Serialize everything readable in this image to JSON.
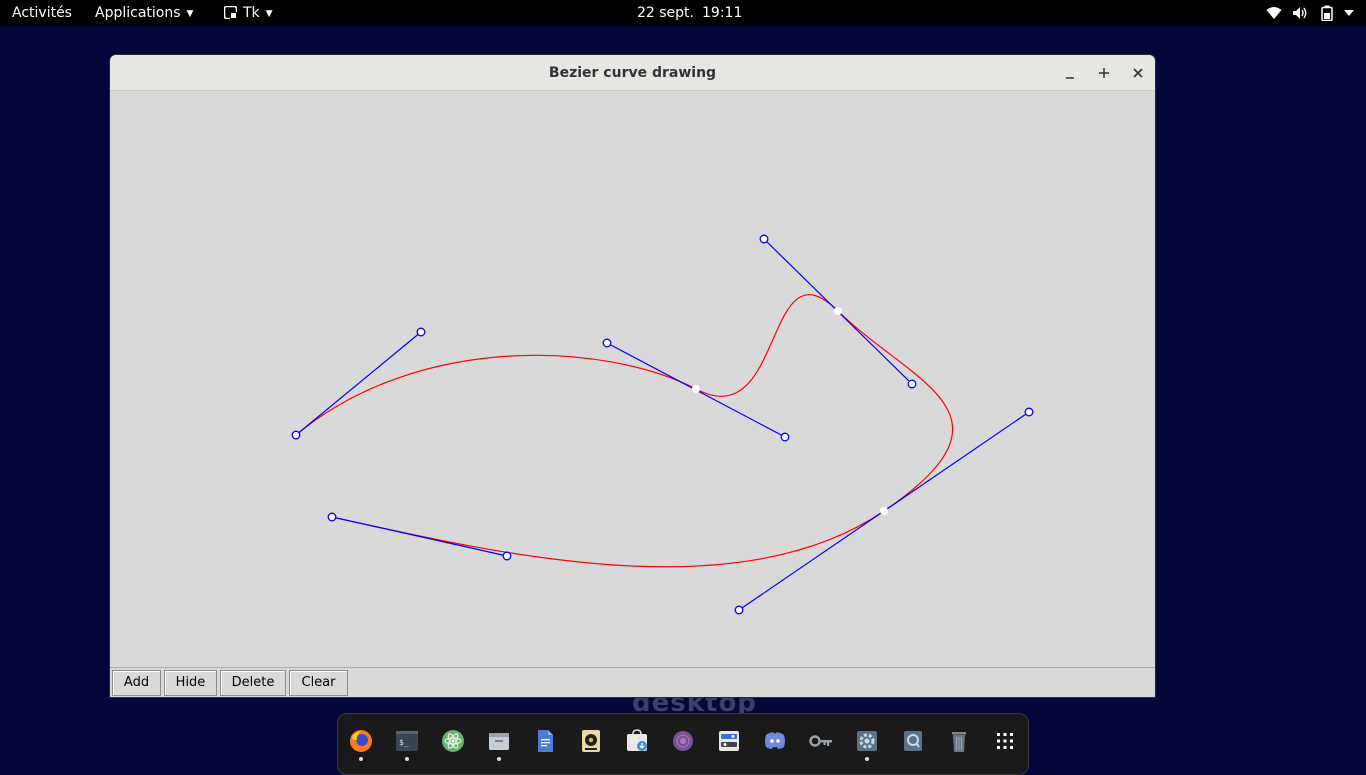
{
  "topbar": {
    "activities": "Activités",
    "applications": "Applications",
    "app_name": "Tk",
    "date": "22 sept.",
    "time": "19:11",
    "tray_icons": [
      "wifi-icon",
      "volume-icon",
      "battery-icon",
      "power-menu-arrow-icon"
    ]
  },
  "window": {
    "title": "Bezier curve drawing",
    "controls": [
      "minimize-icon",
      "maximize-icon",
      "close-icon"
    ]
  },
  "buttons": {
    "add": "Add",
    "hide": "Hide",
    "delete": "Delete",
    "clear": "Clear"
  },
  "background_text": "desktop",
  "drawing": {
    "curve_color": "#ff0000",
    "handle_color": "#0000ff",
    "anchor_color": "#ffffff"
  },
  "dock": {
    "items": [
      {
        "icon": "firefox-icon",
        "running": true
      },
      {
        "icon": "terminal-icon",
        "running": true
      },
      {
        "icon": "atom-icon",
        "running": false
      },
      {
        "icon": "files-icon",
        "running": true
      },
      {
        "icon": "text-editor-icon",
        "running": false
      },
      {
        "icon": "rhythmbox-icon",
        "running": false
      },
      {
        "icon": "software-center-icon",
        "running": false
      },
      {
        "icon": "tor-browser-icon",
        "running": false
      },
      {
        "icon": "settings-panel-icon",
        "running": false
      },
      {
        "icon": "discord-icon",
        "running": false
      },
      {
        "icon": "passwords-icon",
        "running": false
      },
      {
        "icon": "system-settings-icon",
        "running": true
      },
      {
        "icon": "disk-usage-icon",
        "running": false
      },
      {
        "icon": "trash-icon",
        "running": false
      },
      {
        "icon": "show-apps-icon",
        "running": false
      }
    ]
  }
}
